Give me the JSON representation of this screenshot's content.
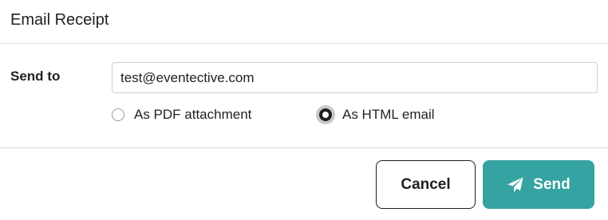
{
  "dialog": {
    "title": "Email Receipt"
  },
  "form": {
    "send_to_label": "Send to",
    "email_value": "test@eventective.com",
    "format_options": [
      {
        "label": "As PDF attachment",
        "checked": false
      },
      {
        "label": "As HTML email",
        "checked": true
      }
    ]
  },
  "footer": {
    "cancel_label": "Cancel",
    "send_label": "Send",
    "send_icon": "paper-plane-icon",
    "send_color": "#35a3a1"
  }
}
